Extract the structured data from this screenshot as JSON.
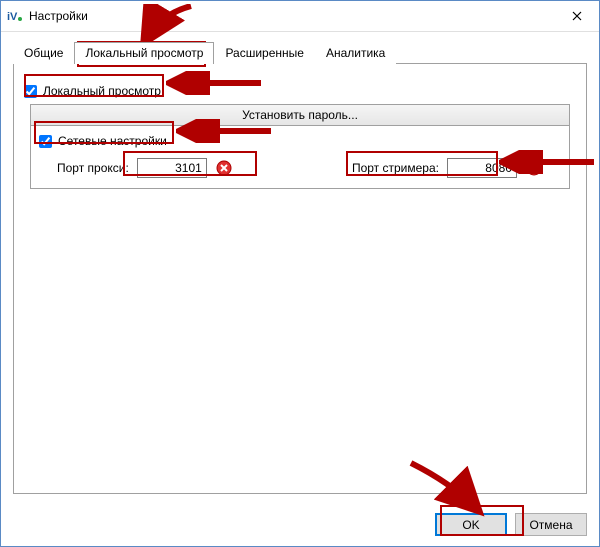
{
  "window": {
    "title": "Настройки"
  },
  "tabs": {
    "general": "Общие",
    "local_view": "Локальный просмотр",
    "advanced": "Расширенные",
    "analytics": "Аналитика"
  },
  "checkboxes": {
    "local_view": "Локальный просмотр",
    "network_settings": "Сетевые настройки"
  },
  "panel": {
    "set_password": "Установить пароль..."
  },
  "ports": {
    "proxy_label": "Порт прокси:",
    "proxy_value": "3101",
    "streamer_label": "Порт стримера:",
    "streamer_value": "8080"
  },
  "buttons": {
    "ok": "OK",
    "cancel": "Отмена"
  }
}
